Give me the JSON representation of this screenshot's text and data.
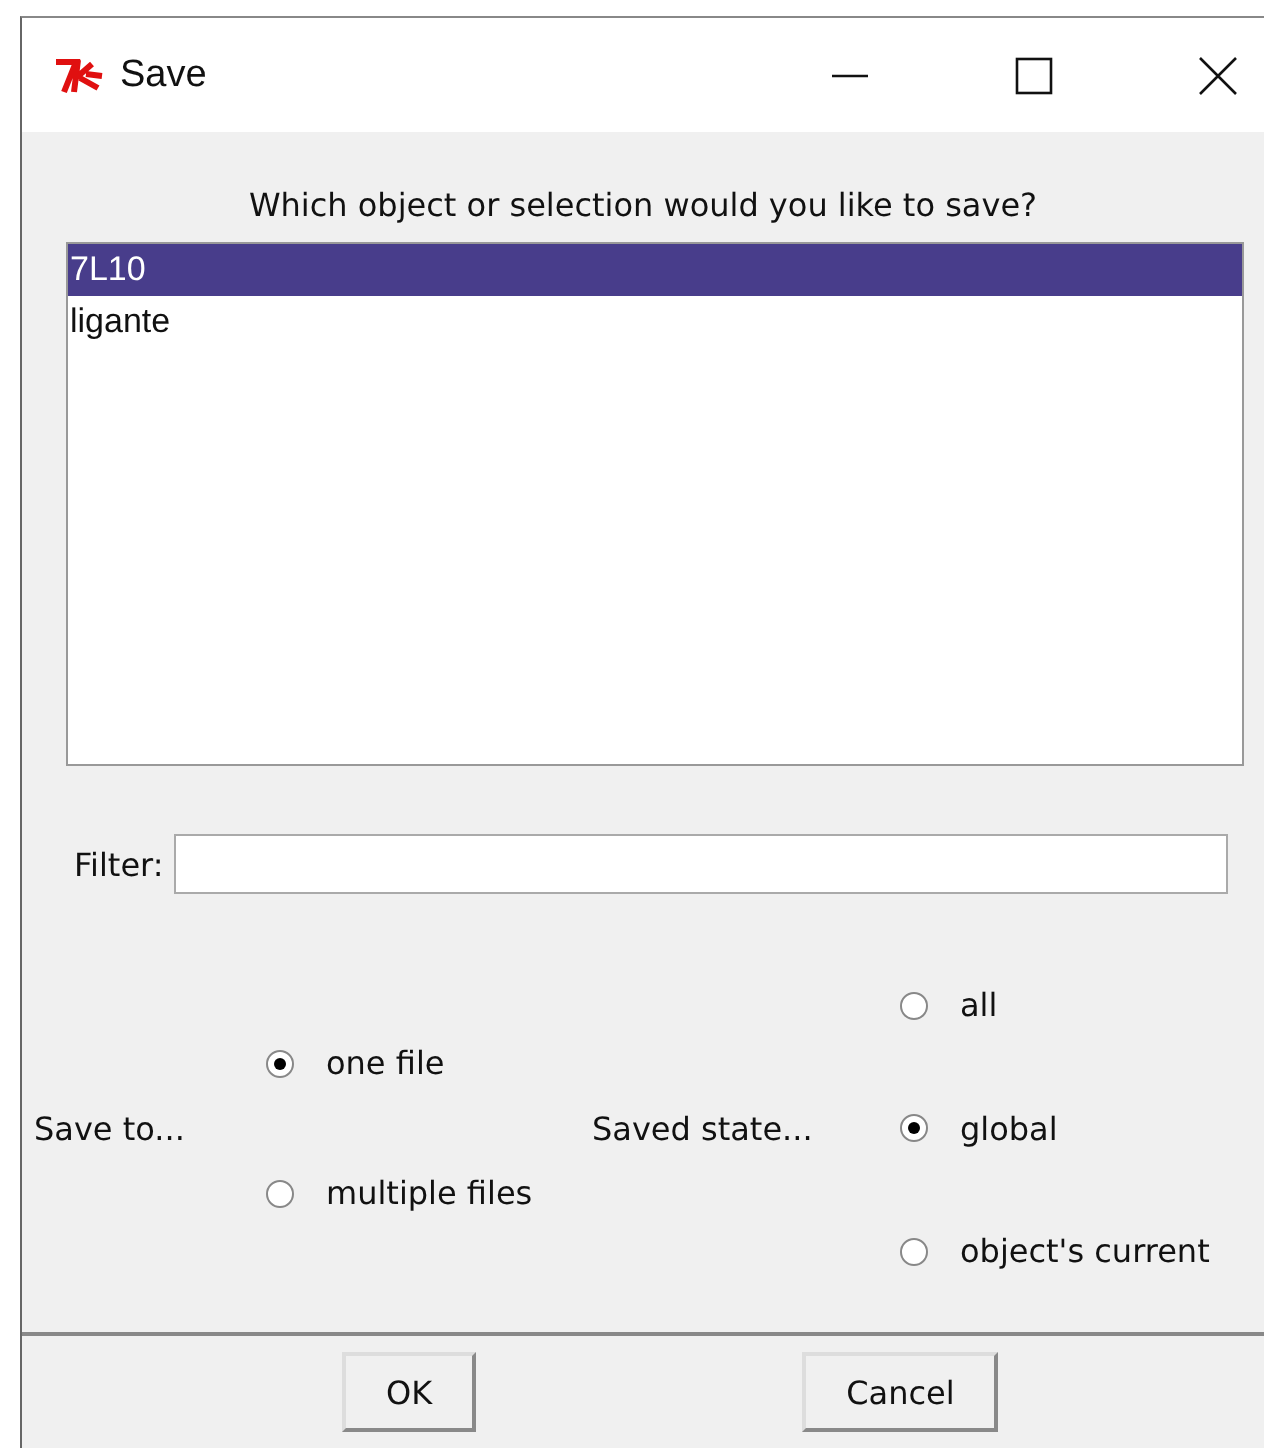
{
  "window": {
    "title": "Save"
  },
  "prompt": "Which object or selection would you like to save?",
  "objects": [
    {
      "label": "7L10",
      "selected": true
    },
    {
      "label": "ligante",
      "selected": false
    }
  ],
  "filter": {
    "label": "Filter:"
  },
  "save_to": {
    "label": "Save to...",
    "options": [
      {
        "label": "one file",
        "selected": true
      },
      {
        "label": "multiple files",
        "selected": false
      }
    ]
  },
  "saved_state": {
    "label": "Saved state...",
    "options": [
      {
        "label": "all",
        "selected": false
      },
      {
        "label": "global",
        "selected": true
      },
      {
        "label": "object's current",
        "selected": false
      }
    ]
  },
  "buttons": [
    "OK",
    "Cancel"
  ]
}
